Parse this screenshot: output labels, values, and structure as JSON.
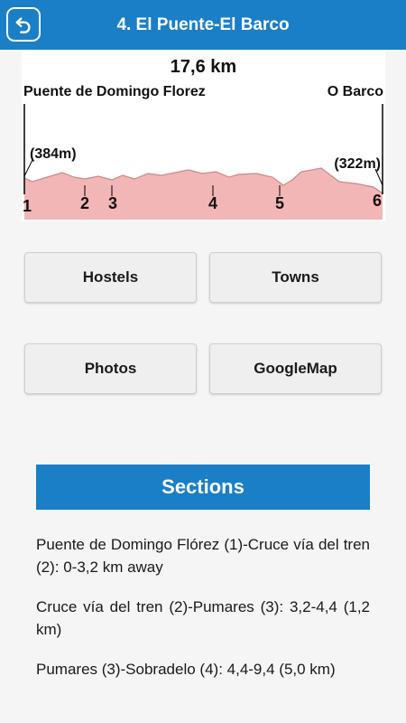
{
  "header": {
    "title": "4. El Puente-El Barco",
    "back_icon": "back-arrow-icon",
    "color": "#1a7fc7"
  },
  "profile": {
    "distance": "17,6 km",
    "start_place": "Puente de Domingo Florez",
    "end_place": "O Barco",
    "start_altitude": "(384m)",
    "end_altitude": "(322m)",
    "markers": [
      "1",
      "2",
      "3",
      "4",
      "5",
      "6"
    ],
    "fill_color": "#f2b8b8"
  },
  "buttons": {
    "hostels": "Hostels",
    "towns": "Towns",
    "photos": "Photos",
    "googlemap": "GoogleMap"
  },
  "sections": {
    "title": "Sections",
    "items": [
      "Puente de Domingo Flórez (1)-Cruce vía del tren (2): 0-3,2 km away",
      "Cruce vía del tren (2)-Pumares (3): 3,2-4,4 (1,2 km)",
      "Pumares (3)-Sobradelo (4): 4,4-9,4 (5,0 km)"
    ]
  }
}
